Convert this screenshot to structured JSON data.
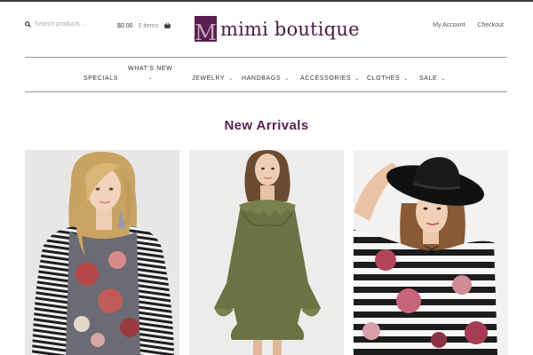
{
  "header": {
    "search_placeholder": "Search products…",
    "cart_total": "$0.00",
    "cart_items": "0 items",
    "logo_mark": "M",
    "logo_text": "mimi boutique",
    "account_links": [
      "My Account",
      "Checkout"
    ]
  },
  "nav": {
    "specials": "SPECIALS",
    "whats_new": "WHAT'S NEW",
    "jewelry": "JEWELRY",
    "handbags": "HANDBAGS",
    "accessories": "ACCESSORIES",
    "clothes": "CLOTHES",
    "sale": "SALE"
  },
  "main": {
    "heading": "New Arrivals"
  },
  "colors": {
    "brand": "#5a1f52",
    "logo_light": "#c9a8c2"
  },
  "icons": [
    "search-icon",
    "basket-icon",
    "chevron-down-icon"
  ]
}
